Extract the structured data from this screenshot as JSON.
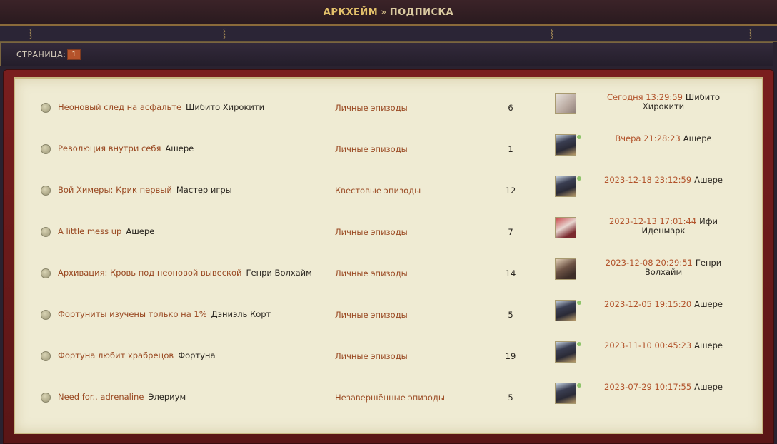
{
  "breadcrumb": {
    "home": "АРКХЕЙМ",
    "separator": "»",
    "current": "ПОДПИСКА"
  },
  "pagination": {
    "label": "СТРАНИЦА:",
    "current_page": "1"
  },
  "colors": {
    "link": "#9a4a23",
    "date": "#b2532b",
    "panel": "#efebd3",
    "frame": "#7a1e1e"
  },
  "topics": [
    {
      "title": "Неоновый след на асфальте",
      "author": "Шибито Хирокити",
      "forum": "Личные эпизоды",
      "replies": "6",
      "last_date": "Сегодня 13:29:59",
      "last_user": "Шибито Хирокити",
      "avatar": "avatar-light",
      "online": false
    },
    {
      "title": "Революция внутри себя",
      "author": "Ашере",
      "forum": "Личные эпизоды",
      "replies": "1",
      "last_date": "Вчера 21:28:23",
      "last_user": "Ашере",
      "avatar": "avatar-dark",
      "online": true
    },
    {
      "title": "Вой Химеры: Крик первый",
      "author": "Мастер игры",
      "forum": "Квестовые эпизоды",
      "replies": "12",
      "last_date": "2023-12-18 23:12:59",
      "last_user": "Ашере",
      "avatar": "avatar-dark",
      "online": true
    },
    {
      "title": "A little mess up",
      "author": "Ашере",
      "forum": "Личные эпизоды",
      "replies": "7",
      "last_date": "2023-12-13 17:01:44",
      "last_user": "Ифи Иденмарк",
      "avatar": "avatar-red",
      "online": false
    },
    {
      "title": "Архивация: Кровь под неоновой вывеской",
      "author": "Генри Волхайм",
      "forum": "Личные эпизоды",
      "replies": "14",
      "last_date": "2023-12-08 20:29:51",
      "last_user": "Генри Волхайм",
      "avatar": "avatar-brown",
      "online": false
    },
    {
      "title": "Фортуниты изучены только на 1%",
      "author": "Дэниэль Корт",
      "forum": "Личные эпизоды",
      "replies": "5",
      "last_date": "2023-12-05 19:15:20",
      "last_user": "Ашере",
      "avatar": "avatar-dark",
      "online": true
    },
    {
      "title": "Фортуна любит храбрецов",
      "author": "Фортуна",
      "forum": "Личные эпизоды",
      "replies": "19",
      "last_date": "2023-11-10 00:45:23",
      "last_user": "Ашере",
      "avatar": "avatar-dark",
      "online": true
    },
    {
      "title": "Need for.. adrenaline",
      "author": "Элериум",
      "forum": "Незавершённые эпизоды",
      "replies": "5",
      "last_date": "2023-07-29 10:17:55",
      "last_user": "Ашере",
      "avatar": "avatar-dark",
      "online": true
    }
  ]
}
